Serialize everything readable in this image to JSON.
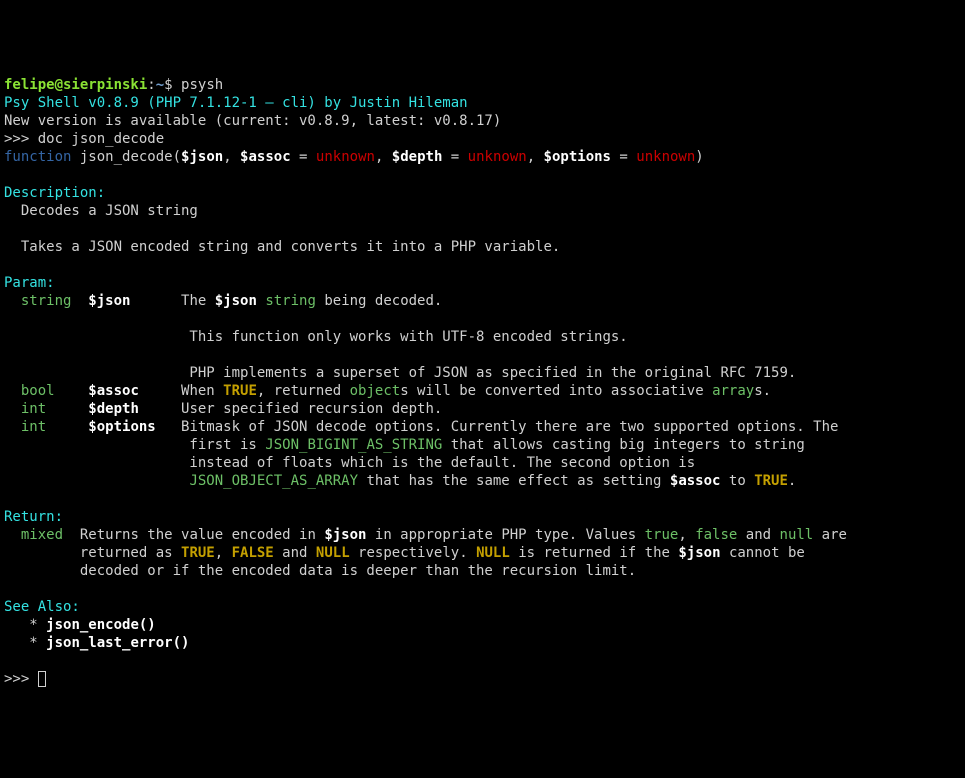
{
  "prompt": {
    "user": "felipe@sierpinski",
    "sep": ":",
    "path": "~",
    "dollar": "$ ",
    "cmd": "psysh"
  },
  "banner": {
    "line1": "Psy Shell v0.8.9 (PHP 7.1.12-1 — cli) by Justin Hileman",
    "line2": "New version is available (current: v0.8.9, latest: v0.8.17)"
  },
  "repl_prompt": ">>> ",
  "doc_cmd": "doc json_decode",
  "sig": {
    "kw_function": "function",
    "sp1": " ",
    "fn": "json_decode(",
    "p1": "$json",
    "c1": ", ",
    "p2": "$assoc",
    "eq": " = ",
    "unk": "unknown",
    "c2": ", ",
    "p3": "$depth",
    "c3": ", ",
    "p4": "$options",
    "close": ")"
  },
  "desc": {
    "hdr": "Description:",
    "l1": "  Decodes a JSON string",
    "l2": "  Takes a JSON encoded string and converts it into a PHP variable."
  },
  "param": {
    "hdr": "Param:",
    "p1_type": "  string",
    "p1_name": "  $json    ",
    "p1_d1a": "  The ",
    "p1_d1b": "$json",
    "p1_d1c": " ",
    "p1_d1d": "string",
    "p1_d1e": " being decoded.",
    "p1_d2": "                      This function only works with UTF-8 encoded strings.",
    "p1_d3": "                      PHP implements a superset of JSON as specified in the original RFC 7159.",
    "p2_type": "  bool  ",
    "p2_name": "  $assoc   ",
    "p2_d1a": "  When ",
    "p2_d1b": "TRUE",
    "p2_d1c": ", returned ",
    "p2_d1d": "object",
    "p2_d1e": "s will be converted into associative ",
    "p2_d1f": "array",
    "p2_d1g": "s.",
    "p3_type": "  int   ",
    "p3_name": "  $depth   ",
    "p3_d1": "  User specified recursion depth.",
    "p4_type": "  int   ",
    "p4_name": "  $options ",
    "p4_d1": "  Bitmask of JSON decode options. Currently there are two supported options. The",
    "p4_d2a": "                      first is ",
    "p4_d2b": "JSON_BIGINT_AS_STRING",
    "p4_d2c": " that allows casting big integers to string",
    "p4_d3": "                      instead of floats which is the default. The second option is",
    "p4_d4a": "                      ",
    "p4_d4b": "JSON_OBJECT_AS_ARRAY",
    "p4_d4c": " that has the same effect as setting ",
    "p4_d4d": "$assoc",
    "p4_d4e": " to ",
    "p4_d4f": "TRUE",
    "p4_d4g": "."
  },
  "ret": {
    "hdr": "Return:",
    "type": "  mixed",
    "d1a": "  Returns the value encoded in ",
    "d1b": "$json",
    "d1c": " in appropriate PHP type. Values ",
    "d1d": "true",
    "d1e": ", ",
    "d1f": "false",
    "d1g": " and ",
    "d1h": "null",
    "d1i": " are",
    "d2a": "         returned as ",
    "d2b": "TRUE",
    "d2c": ", ",
    "d2d": "FALSE",
    "d2e": " and ",
    "d2f": "NULL",
    "d2g": " respectively. ",
    "d2h": "NULL",
    "d2i": " is returned if the ",
    "d2j": "$json",
    "d2k": " cannot be",
    "d3": "         decoded or if the encoded data is deeper than the recursion limit."
  },
  "see": {
    "hdr": "See Also:",
    "i1": "   * ",
    "i1b": "json_encode()",
    "i2": "   * ",
    "i2b": "json_last_error()"
  }
}
